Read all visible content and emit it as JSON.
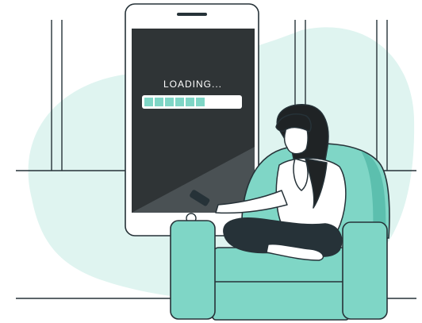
{
  "phone_screen": {
    "status_text": "LOADING...",
    "progress": {
      "filled_segments": 6,
      "total_segments": 10
    }
  },
  "colors": {
    "accent": "#7fd6c6",
    "accent_dark": "#5cbfae",
    "blob": "#dff4f0",
    "screen": "#2f3436",
    "outline": "#263238",
    "hair": "#1f2325",
    "pants": "#263238",
    "skin": "#ffffff"
  },
  "icons": {
    "phone_speaker": "speaker-slot-icon",
    "phone_home": "home-button-icon"
  }
}
